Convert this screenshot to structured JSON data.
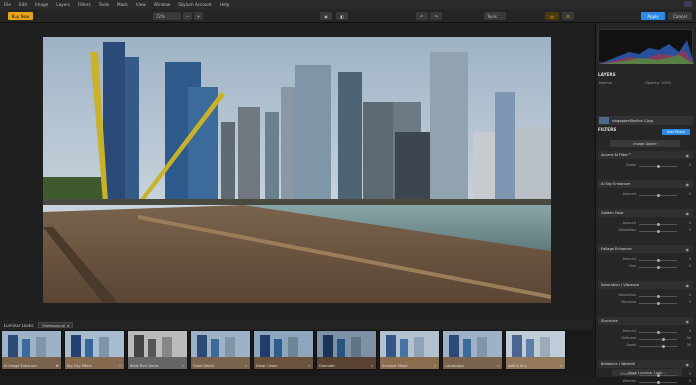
{
  "menu": {
    "items": [
      "File",
      "Edit",
      "Image",
      "Layers",
      "Filters",
      "Tools",
      "Mask",
      "View",
      "Window",
      "Skylum Account",
      "Help"
    ]
  },
  "toolbar": {
    "buy_now": "Buy Now",
    "zoom": "72%",
    "tools": "Tools",
    "apply": "Apply",
    "cancel": "Cancel"
  },
  "panel": {
    "layers_title": "LAYERS",
    "blend_mode": "Normal",
    "opacity": "Opacity: 100%",
    "layer_name": "singaporeSkyline-1.jpg",
    "filters_title": "FILTERS",
    "add_filters": "Add Filters",
    "image_aware": "Image Aware",
    "save_look": "Save Luminar Look..."
  },
  "filters": [
    {
      "name": "Accent AI Filter™",
      "sliders": [
        {
          "name": "Boost",
          "value": "0",
          "pos": 0.5
        }
      ]
    },
    {
      "name": "AI Sky Enhancer",
      "sliders": [
        {
          "name": "Amount",
          "value": "0",
          "pos": 0.5
        }
      ]
    },
    {
      "name": "Golden Hour",
      "sliders": [
        {
          "name": "Amount",
          "value": "0",
          "pos": 0.5
        },
        {
          "name": "Saturation",
          "value": "0",
          "pos": 0.5
        }
      ]
    },
    {
      "name": "Foliage Enhancer",
      "sliders": [
        {
          "name": "Amount",
          "value": "0",
          "pos": 0.5
        },
        {
          "name": "Hue",
          "value": "0",
          "pos": 0.5
        }
      ]
    },
    {
      "name": "Saturation / Vibrance",
      "sliders": [
        {
          "name": "Saturation",
          "value": "0",
          "pos": 0.5
        },
        {
          "name": "Vibrance",
          "value": "0",
          "pos": 0.5
        }
      ]
    },
    {
      "name": "Structure",
      "sliders": [
        {
          "name": "Amount",
          "value": "0",
          "pos": 0.5
        },
        {
          "name": "Softness",
          "value": "30",
          "pos": 0.65
        },
        {
          "name": "Boost",
          "value": "30",
          "pos": 0.65
        }
      ]
    },
    {
      "name": "Brilliance / Warmth",
      "sliders": [
        {
          "name": "Vividness",
          "value": "0",
          "pos": 0.5
        },
        {
          "name": "Warmth",
          "value": "0",
          "pos": 0.5
        }
      ]
    }
  ],
  "looks": {
    "label": "Luminar Looks:",
    "selected": "Professional",
    "items": [
      "AI Image Enhancer",
      "Big City Effect",
      "B&W Rich Darks",
      "Good Detail",
      "Deep Colors",
      "Dramatic",
      "Summer Mood",
      "Landscape",
      "Soft & Airy"
    ]
  }
}
